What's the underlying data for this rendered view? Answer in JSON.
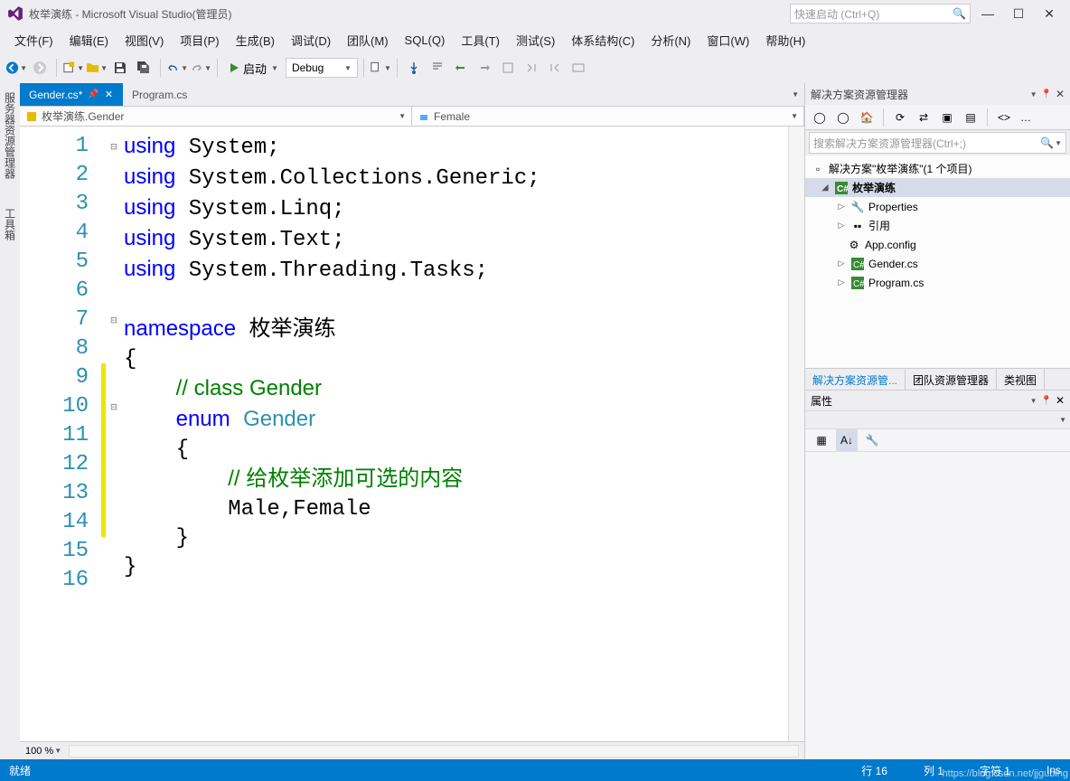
{
  "title": "枚举演练 - Microsoft Visual Studio(管理员)",
  "quickLaunchPlaceholder": "快速启动 (Ctrl+Q)",
  "menu": [
    "文件(F)",
    "编辑(E)",
    "视图(V)",
    "项目(P)",
    "生成(B)",
    "调试(D)",
    "团队(M)",
    "SQL(Q)",
    "工具(T)",
    "测试(S)",
    "体系结构(C)",
    "分析(N)",
    "窗口(W)",
    "帮助(H)"
  ],
  "startLabel": "启动",
  "debugConfig": "Debug",
  "tabs": {
    "active": "Gender.cs*",
    "activePinTooltip": "固定",
    "inactive": "Program.cs"
  },
  "nav": {
    "left": "枚举演练.Gender",
    "right": "Female"
  },
  "code": {
    "lines": [
      {
        "n": 1,
        "fold": "⊟",
        "mod": false,
        "html": "<span class='kw'>using</span> System;"
      },
      {
        "n": 2,
        "fold": "",
        "mod": false,
        "html": "<span class='kw'>using</span> System.Collections.Generic;"
      },
      {
        "n": 3,
        "fold": "",
        "mod": false,
        "html": "<span class='kw'>using</span> System.Linq;"
      },
      {
        "n": 4,
        "fold": "",
        "mod": false,
        "html": "<span class='kw'>using</span> System.Text;"
      },
      {
        "n": 5,
        "fold": "",
        "mod": false,
        "html": "<span class='kw'>using</span> System.Threading.Tasks;"
      },
      {
        "n": 6,
        "fold": "",
        "mod": false,
        "html": ""
      },
      {
        "n": 7,
        "fold": "⊟",
        "mod": false,
        "html": "<span class='kw'>namespace</span> 枚举演练"
      },
      {
        "n": 8,
        "fold": "",
        "mod": false,
        "html": "{"
      },
      {
        "n": 9,
        "fold": "",
        "mod": true,
        "html": "    <span class='comment'>// class Gender</span>"
      },
      {
        "n": 10,
        "fold": "⊟",
        "mod": true,
        "html": "    <span class='kw'>enum</span> <span class='type'>Gender</span>"
      },
      {
        "n": 11,
        "fold": "",
        "mod": true,
        "html": "    {"
      },
      {
        "n": 12,
        "fold": "",
        "mod": true,
        "html": "        <span class='comment'>// 给枚举添加可选的内容</span>"
      },
      {
        "n": 13,
        "fold": "",
        "mod": true,
        "html": "        Male,Female"
      },
      {
        "n": 14,
        "fold": "",
        "mod": true,
        "html": "    }"
      },
      {
        "n": 15,
        "fold": "",
        "mod": false,
        "html": "}"
      },
      {
        "n": 16,
        "fold": "",
        "mod": false,
        "html": ""
      }
    ]
  },
  "zoom": "100 %",
  "solutionExplorer": {
    "title": "解决方案资源管理器",
    "searchPlaceholder": "搜索解决方案资源管理器(Ctrl+;)",
    "root": "解决方案\"枚举演练\"(1 个项目)",
    "project": "枚举演练",
    "items": [
      "Properties",
      "引用",
      "App.config",
      "Gender.cs",
      "Program.cs"
    ]
  },
  "panelTabs": [
    "解决方案资源管...",
    "团队资源管理器",
    "类视图"
  ],
  "propertiesTitle": "属性",
  "leftDock": [
    "服务器资源管理器",
    "工具箱"
  ],
  "status": {
    "ready": "就绪",
    "line": "行 16",
    "col": "列 1",
    "char": "字符 1",
    "ins": "Ins"
  },
  "watermark": "https://blog.csdn.net/jjgubing"
}
